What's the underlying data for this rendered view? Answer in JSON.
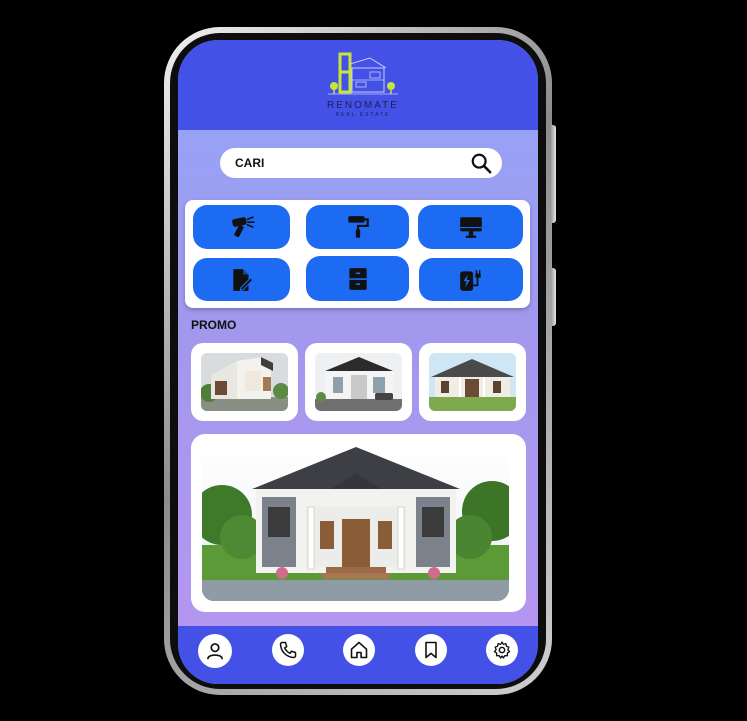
{
  "brand": {
    "name": "RENOMATE",
    "tagline": "REAL ESTATE"
  },
  "search": {
    "label": "CARI"
  },
  "categories": [
    {
      "icon": "hammer-drill-icon"
    },
    {
      "icon": "paint-roller-icon"
    },
    {
      "icon": "computer-monitor-icon"
    },
    {
      "icon": "document-edit-icon"
    },
    {
      "icon": "cabinet-icon"
    },
    {
      "icon": "electric-plug-icon"
    }
  ],
  "promo": {
    "label": "PROMO"
  },
  "bottom_nav": [
    {
      "icon": "user-icon"
    },
    {
      "icon": "phone-icon"
    },
    {
      "icon": "home-icon"
    },
    {
      "icon": "bookmark-icon"
    },
    {
      "icon": "settings-gear-icon"
    }
  ],
  "colors": {
    "header": "#4351e6",
    "category_button": "#1d6bf2",
    "logo_accent": "#c7e43a"
  }
}
